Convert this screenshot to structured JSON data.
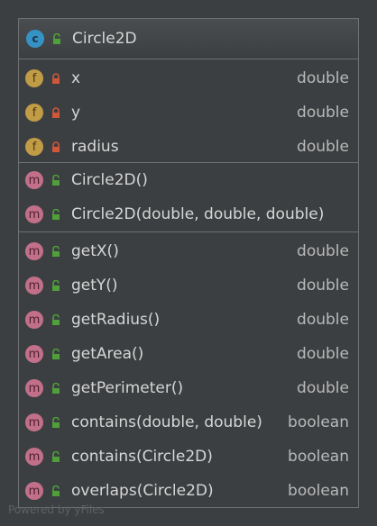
{
  "class": {
    "name": "Circle2D",
    "kind_letter": "c",
    "fields": [
      {
        "name": "x",
        "type": "double",
        "kind": "f",
        "visibility": "private"
      },
      {
        "name": "y",
        "type": "double",
        "kind": "f",
        "visibility": "private"
      },
      {
        "name": "radius",
        "type": "double",
        "kind": "f",
        "visibility": "private"
      }
    ],
    "constructors": [
      {
        "name": "Circle2D()",
        "type": "",
        "kind": "m",
        "visibility": "public"
      },
      {
        "name": "Circle2D(double, double, double)",
        "type": "",
        "kind": "m",
        "visibility": "public"
      }
    ],
    "methods": [
      {
        "name": "getX()",
        "type": "double",
        "kind": "m",
        "visibility": "public"
      },
      {
        "name": "getY()",
        "type": "double",
        "kind": "m",
        "visibility": "public"
      },
      {
        "name": "getRadius()",
        "type": "double",
        "kind": "m",
        "visibility": "public"
      },
      {
        "name": "getArea()",
        "type": "double",
        "kind": "m",
        "visibility": "public"
      },
      {
        "name": "getPerimeter()",
        "type": "double",
        "kind": "m",
        "visibility": "public"
      },
      {
        "name": "contains(double, double)",
        "type": "boolean",
        "kind": "m",
        "visibility": "public"
      },
      {
        "name": "contains(Circle2D)",
        "type": "boolean",
        "kind": "m",
        "visibility": "public"
      },
      {
        "name": "overlaps(Circle2D)",
        "type": "boolean",
        "kind": "m",
        "visibility": "public"
      }
    ]
  },
  "icons": {
    "public_lock_color": "#4fa03a",
    "private_lock_color": "#d0573a"
  },
  "watermark": "Powered by yFiles"
}
